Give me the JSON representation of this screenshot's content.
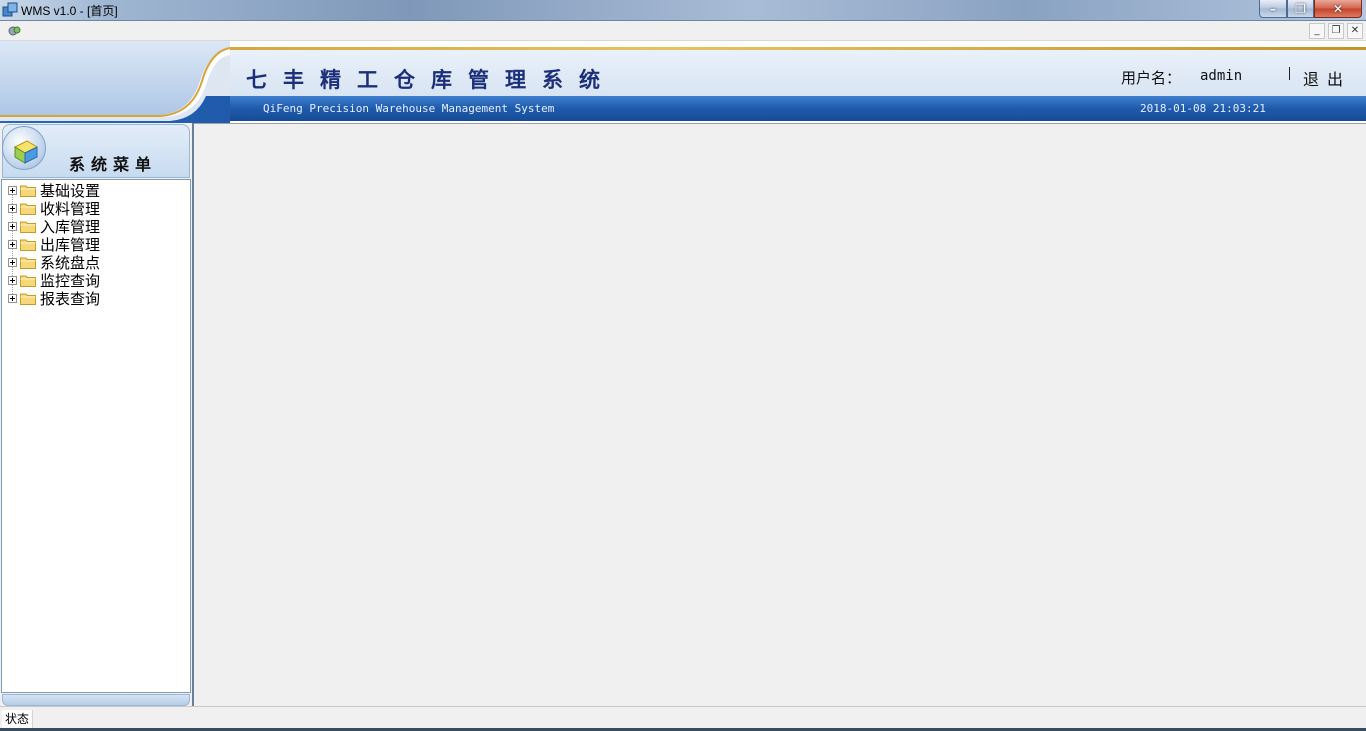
{
  "window": {
    "title": "WMS v1.0  - [首页]"
  },
  "header": {
    "app_title": "七丰精工仓库管理系统",
    "app_subtitle": "QiFeng Precision Warehouse Management System",
    "datetime": "2018-01-08 21:03:21",
    "user_label": "用户名：",
    "user_name": "admin",
    "logout_label": "退出"
  },
  "sidebar": {
    "title": "系统菜单",
    "items": [
      {
        "label": "基础设置"
      },
      {
        "label": "收料管理"
      },
      {
        "label": "入库管理"
      },
      {
        "label": "出库管理"
      },
      {
        "label": "系统盘点"
      },
      {
        "label": "监控查询"
      },
      {
        "label": "报表查询"
      }
    ]
  },
  "statusbar": {
    "status_text": "状态"
  },
  "icons": {
    "app": "wms-app-icon",
    "tree_node": "folder-icon",
    "expander": "plus-expander-icon"
  },
  "colors": {
    "title_text": "#1c2f7a",
    "banner_blue": "#1f5aab",
    "accent_gold": "#d6a53a"
  }
}
